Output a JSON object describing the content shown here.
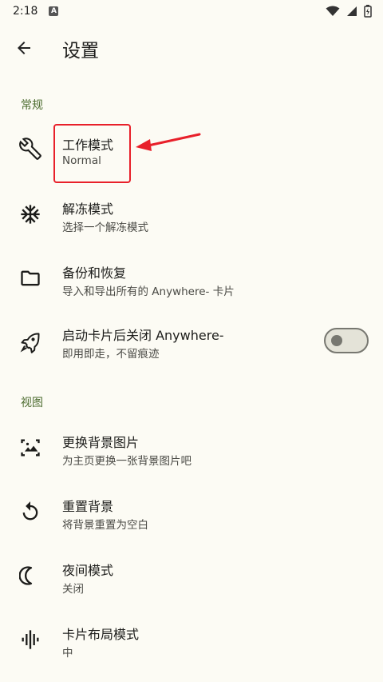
{
  "status_bar": {
    "time": "2:18",
    "badge": "A"
  },
  "app_bar": {
    "title": "设置"
  },
  "sections": [
    {
      "header": "常规"
    },
    {
      "header": "视图"
    }
  ],
  "items": [
    {
      "title": "工作模式",
      "subtitle": "Normal",
      "icon": "wrench-icon"
    },
    {
      "title": "解冻模式",
      "subtitle": "选择一个解冻模式",
      "icon": "snowflake-icon"
    },
    {
      "title": "备份和恢复",
      "subtitle": "导入和导出所有的 Anywhere- 卡片",
      "icon": "folder-icon"
    },
    {
      "title": "启动卡片后关闭 Anywhere-",
      "subtitle": "即用即走，不留痕迹",
      "icon": "rocket-icon",
      "toggle_on": false
    },
    {
      "title": "更换背景图片",
      "subtitle": "为主页更换一张背景图片吧",
      "icon": "image-icon"
    },
    {
      "title": "重置背景",
      "subtitle": "将背景重置为空白",
      "icon": "restore-icon"
    },
    {
      "title": "夜间模式",
      "subtitle": "关闭",
      "icon": "moon-icon"
    },
    {
      "title": "卡片布局模式",
      "subtitle": "中",
      "icon": "waveform-icon"
    }
  ],
  "colors": {
    "background": "#fcfbf4",
    "section_header": "#4b6b2e",
    "annotation": "#e8202a"
  }
}
